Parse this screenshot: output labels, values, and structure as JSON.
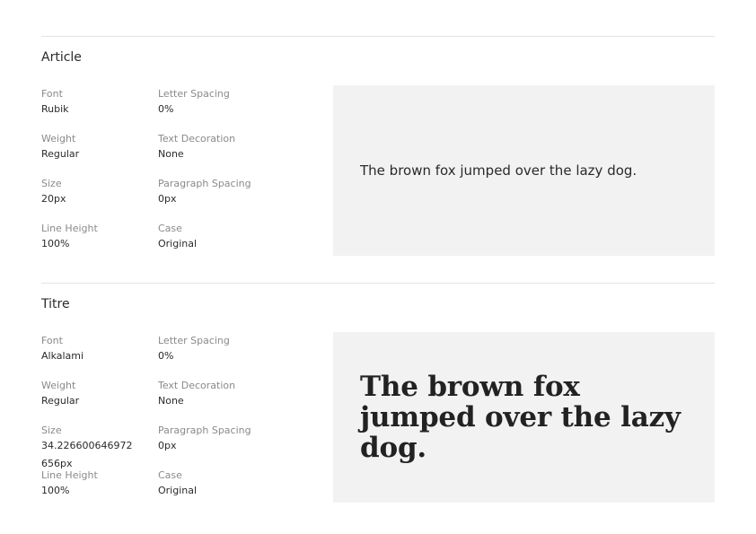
{
  "labels": {
    "font": "Font",
    "weight": "Weight",
    "size": "Size",
    "line_height": "Line Height",
    "letter_spacing": "Letter Spacing",
    "text_decoration": "Text Decoration",
    "paragraph_spacing": "Paragraph Spacing",
    "case": "Case"
  },
  "styles": [
    {
      "name": "Article",
      "font": "Rubik",
      "weight": "Regular",
      "size": "20px",
      "line_height": "100%",
      "letter_spacing": "0%",
      "text_decoration": "None",
      "paragraph_spacing": "0px",
      "case": "Original",
      "preview": "The brown fox jumped over the lazy dog."
    },
    {
      "name": "Titre",
      "font": "Alkalami",
      "weight": "Regular",
      "size": "34.226600646972656px",
      "line_height": "100%",
      "letter_spacing": "0%",
      "text_decoration": "None",
      "paragraph_spacing": "0px",
      "case": "Original",
      "preview": "The brown fox jumped over the lazy dog."
    }
  ]
}
